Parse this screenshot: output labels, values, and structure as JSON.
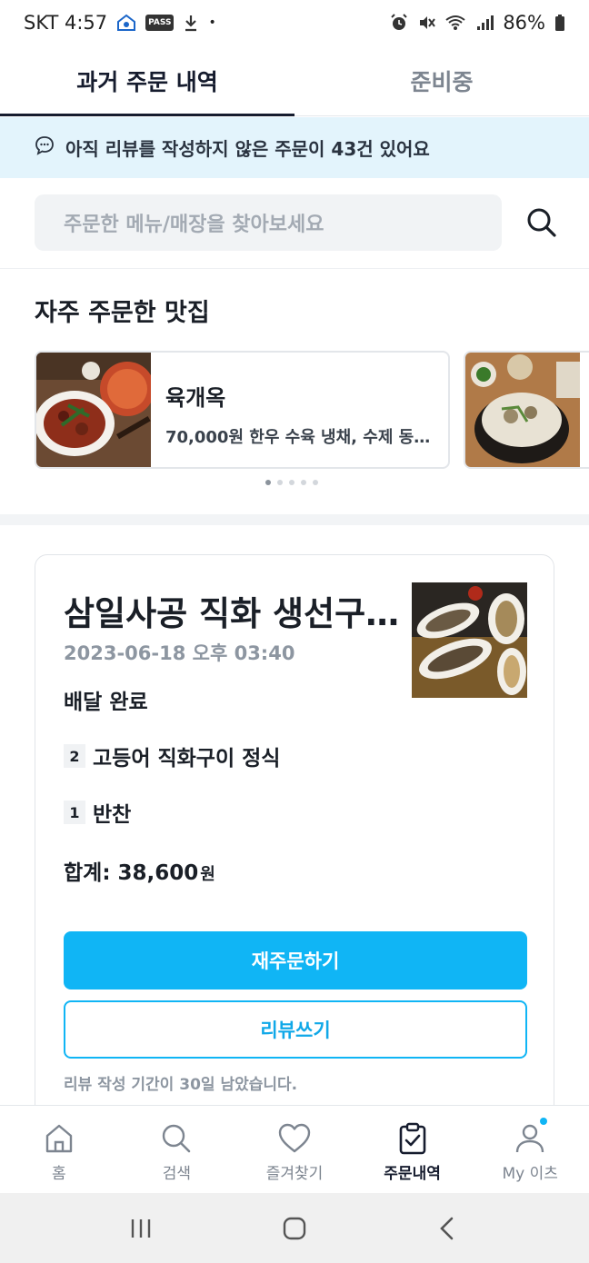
{
  "status_bar": {
    "carrier_time": "SKT 4:57",
    "pass_badge": "PASS",
    "dot": "•",
    "battery": "86%",
    "icons": [
      "home-badge-icon",
      "pass-app-icon",
      "download-icon",
      "alarm-icon",
      "mute-icon",
      "wifi-icon",
      "signal-icon",
      "battery-icon"
    ]
  },
  "tabs": [
    {
      "label": "과거 주문 내역",
      "active": true
    },
    {
      "label": "준비중",
      "active": false
    }
  ],
  "banner": {
    "icon": "chat-bubble-icon",
    "text": "아직 리뷰를 작성하지 않은 주문이 43건 있어요"
  },
  "search": {
    "placeholder": "주문한 메뉴/매장을 찾아보세요",
    "icon": "search-icon"
  },
  "frequent": {
    "title": "자주 주문한 맛집",
    "cards": [
      {
        "name": "육개옥",
        "desc": "70,000원 한우 수육 냉채, 수제 동…"
      }
    ],
    "dots_total": 5,
    "dots_active": 0
  },
  "order": {
    "store": "삼일사공 직화 생선구…",
    "date": "2023-06-18 오후 03:40",
    "status": "배달 완료",
    "items": [
      {
        "qty": "2",
        "name": "고등어 직화구이 정식"
      },
      {
        "qty": "1",
        "name": "반찬"
      }
    ],
    "total_label": "합계: 38,600",
    "total_unit": "원",
    "reorder_label": "재주문하기",
    "review_label": "리뷰쓰기",
    "review_note": "리뷰 작성 기간이 30일 남았습니다."
  },
  "bottom_nav": [
    {
      "label": "홈",
      "icon": "home-icon",
      "active": false
    },
    {
      "label": "검색",
      "icon": "search-icon",
      "active": false
    },
    {
      "label": "즐겨찾기",
      "icon": "heart-icon",
      "active": false
    },
    {
      "label": "주문내역",
      "icon": "clipboard-check-icon",
      "active": true
    },
    {
      "label": "My 이츠",
      "icon": "person-icon",
      "active": false,
      "badge": true
    }
  ],
  "colors": {
    "accent": "#10b5f5",
    "banner_bg": "#e3f4fc",
    "dark_text": "#161c2e",
    "muted_text": "#8d96a1"
  }
}
